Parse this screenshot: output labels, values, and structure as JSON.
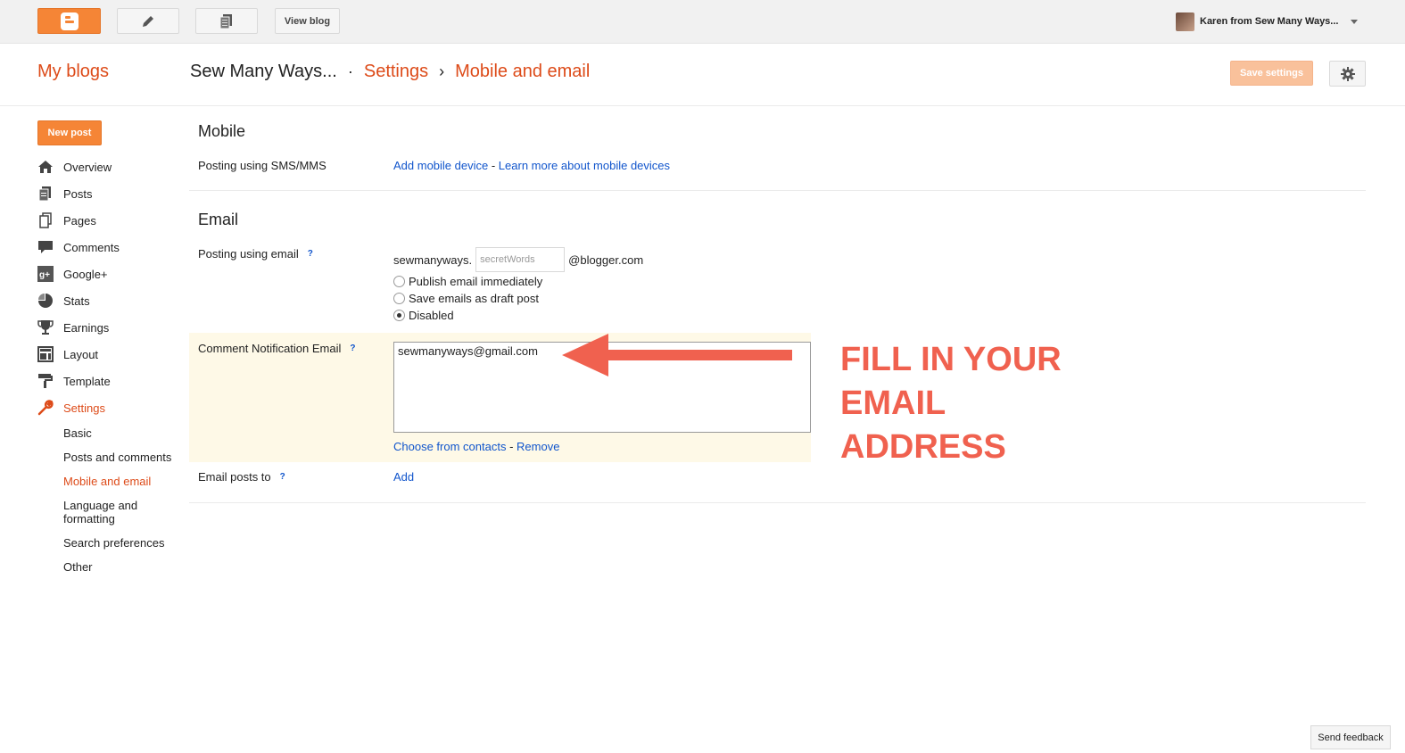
{
  "topbar": {
    "view_blog": "View blog",
    "user_name": "Karen from Sew Many Ways..."
  },
  "header": {
    "my_blogs": "My blogs",
    "blog_name": "Sew Many Ways...",
    "crumb_settings": "Settings",
    "crumb_current": "Mobile and email",
    "save_settings": "Save settings"
  },
  "sidebar": {
    "new_post": "New post",
    "items": [
      {
        "label": "Overview",
        "icon": "home-icon"
      },
      {
        "label": "Posts",
        "icon": "posts-icon"
      },
      {
        "label": "Pages",
        "icon": "pages-icon"
      },
      {
        "label": "Comments",
        "icon": "comments-icon"
      },
      {
        "label": "Google+",
        "icon": "google-plus-icon"
      },
      {
        "label": "Stats",
        "icon": "stats-icon"
      },
      {
        "label": "Earnings",
        "icon": "trophy-icon"
      },
      {
        "label": "Layout",
        "icon": "layout-icon"
      },
      {
        "label": "Template",
        "icon": "template-icon"
      },
      {
        "label": "Settings",
        "icon": "wrench-icon"
      }
    ],
    "sub_items": [
      "Basic",
      "Posts and comments",
      "Mobile and email",
      "Language and formatting",
      "Search preferences",
      "Other"
    ]
  },
  "mobile": {
    "title": "Mobile",
    "sms_label": "Posting using SMS/MMS",
    "add_device": "Add mobile device",
    "dash": " - ",
    "learn_more": "Learn more about mobile devices"
  },
  "email": {
    "title": "Email",
    "posting_label": "Posting using email",
    "qmark": "?",
    "prefix": "sewmanyways.",
    "secret_placeholder": "secretWords",
    "suffix": "@blogger.com",
    "options": [
      "Publish email immediately",
      "Save emails as draft post",
      "Disabled"
    ],
    "selected_option": "Disabled",
    "comment_label": "Comment Notification Email",
    "comment_value": "sewmanyways@gmail.com",
    "choose_contacts": "Choose from contacts",
    "remove": "Remove",
    "posts_to_label": "Email posts to",
    "add": "Add"
  },
  "annotation": {
    "text_line1": "FILL IN YOUR",
    "text_line2": "EMAIL",
    "text_line3": "ADDRESS",
    "color": "#f0614f"
  },
  "footer": {
    "send_feedback": "Send feedback"
  },
  "colors": {
    "accent": "#dd4b19",
    "button_orange": "#f58536",
    "link": "#1155cc"
  }
}
